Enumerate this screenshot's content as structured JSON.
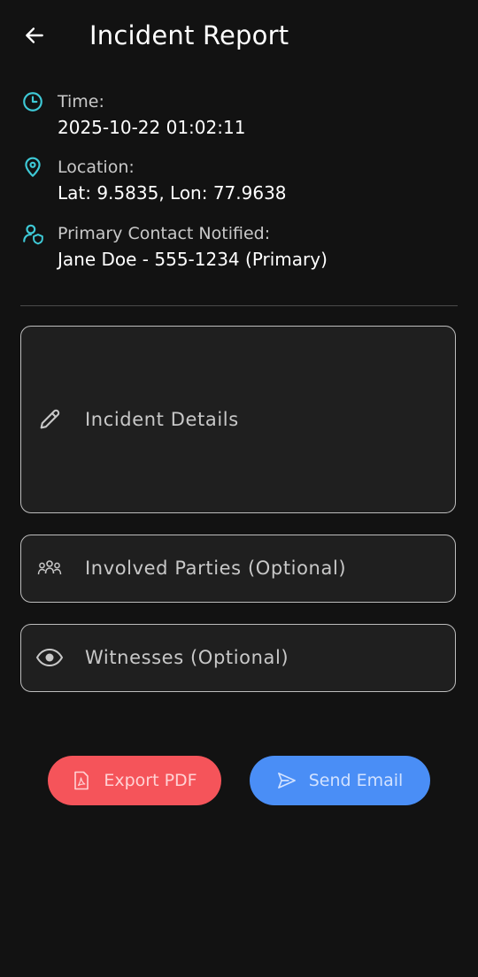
{
  "header": {
    "title": "Incident Report",
    "back_icon": "arrow-left-icon"
  },
  "info": {
    "time": {
      "icon": "clock-icon",
      "label": "Time:",
      "value": "2025-10-22 01:02:11"
    },
    "location": {
      "icon": "map-pin-icon",
      "label": "Location:",
      "value": "Lat: 9.5835, Lon: 77.9638"
    },
    "contact": {
      "icon": "user-shield-icon",
      "label": "Primary Contact Notified:",
      "value": "Jane Doe - 555-1234 (Primary)"
    }
  },
  "form": {
    "incident_details": {
      "icon": "pencil-icon",
      "label": "Incident Details"
    },
    "involved_parties": {
      "icon": "people-group-icon",
      "label": "Involved Parties (Optional)"
    },
    "witnesses": {
      "icon": "eye-icon",
      "label": "Witnesses (Optional)"
    }
  },
  "actions": {
    "export_pdf": {
      "icon": "pdf-file-icon",
      "label": "Export PDF",
      "color": "#f5545a"
    },
    "send_email": {
      "icon": "send-icon",
      "label": "Send Email",
      "color": "#4a8ef6"
    }
  },
  "colors": {
    "background": "#121212",
    "accent_icon": "#3ec9d6",
    "field_background": "#1f1f1f",
    "field_border": "#bdbdbd"
  }
}
